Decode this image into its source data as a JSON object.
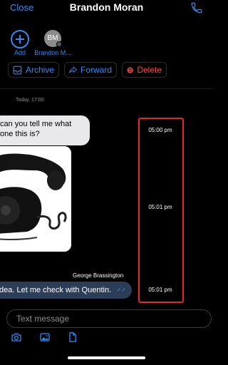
{
  "header": {
    "close_label": "Close",
    "title": "Brandon Moran",
    "call_icon": "phone-icon"
  },
  "participants": {
    "add_label": "Add",
    "contact_initials": "BM",
    "contact_label": "Brandon M..."
  },
  "actions": {
    "archive": "Archive",
    "forward": "Forward",
    "delete": "Delete"
  },
  "conversation": {
    "date_separator": "Today, 17:00",
    "messages": [
      {
        "line1": "can you tell me what",
        "line2": "one this is?",
        "time": "05:00 pm"
      },
      {
        "type": "image",
        "alt": "black rotary telephone",
        "time": "05:01 pm"
      },
      {
        "sender": "George Brassington",
        "text": "dea. Let me check with Quentin.",
        "time": "05:01 pm"
      }
    ]
  },
  "composer": {
    "placeholder": "Text message",
    "tool_icons": [
      "camera-icon",
      "image-icon",
      "document-icon"
    ]
  },
  "colors": {
    "accent": "#2f8cf5",
    "danger": "#ff453a",
    "highlight": "#e5272d"
  }
}
